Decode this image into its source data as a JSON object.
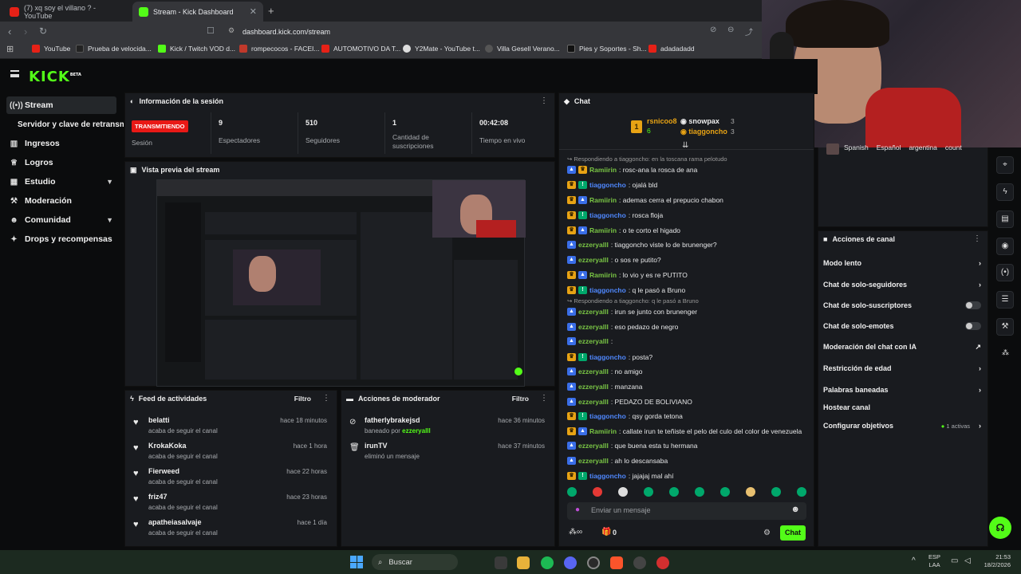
{
  "browser": {
    "tabs": [
      {
        "title": "(7) xq soy el villano ? - YouTube",
        "active": false
      },
      {
        "title": "Stream - Kick Dashboard",
        "active": true
      }
    ],
    "url": "dashboard.kick.com/stream",
    "bookmarks": [
      "YouTube",
      "Prueba de velocida...",
      "Kick / Twitch VOD d...",
      "rompecocos - FACEI...",
      "AUTOMOTIVO DA T...",
      "Y2Mate - YouTube t...",
      "Villa Gesell Verano...",
      "Pies y Soportes - Sh...",
      "adadadadd"
    ]
  },
  "brand": {
    "logo": "KICK",
    "beta": "BETA"
  },
  "sidebar": {
    "items": [
      {
        "label": "Stream",
        "active": true,
        "icon": "broadcast-icon"
      },
      {
        "label": "Servidor y clave de retransmisión",
        "sub": true
      },
      {
        "label": "Ingresos",
        "icon": "chart-icon"
      },
      {
        "label": "Logros",
        "icon": "trophy-icon"
      },
      {
        "label": "Estudio",
        "icon": "grid-icon",
        "chevron": true
      },
      {
        "label": "Moderación",
        "icon": "wrench-icon"
      },
      {
        "label": "Comunidad",
        "icon": "users-icon",
        "chevron": true
      },
      {
        "label": "Drops y recompensas",
        "icon": "gift-icon"
      }
    ]
  },
  "session": {
    "title": "Información de la sesión",
    "status_badge": "TRANSMITIENDO",
    "status_label": "Sesión",
    "stats": [
      {
        "value": "9",
        "label": "Espectadores"
      },
      {
        "value": "510",
        "label": "Seguidores"
      },
      {
        "value": "1",
        "label": "Cantidad de suscripciones"
      },
      {
        "value": "00:42:08",
        "label": "Tiempo en vivo"
      }
    ]
  },
  "preview": {
    "title": "Vista previa del stream"
  },
  "feed": {
    "title": "Feed de actividades",
    "filter": "Filtro",
    "items": [
      {
        "name": "belatti",
        "sub": "acaba de seguir el canal",
        "time": "hace 18 minutos"
      },
      {
        "name": "KrokaKoka",
        "sub": "acaba de seguir el canal",
        "time": "hace 1 hora"
      },
      {
        "name": "Fierweed",
        "sub": "acaba de seguir el canal",
        "time": "hace 22 horas"
      },
      {
        "name": "friz47",
        "sub": "acaba de seguir el canal",
        "time": "hace 23 horas"
      },
      {
        "name": "apatheiasalvaje",
        "sub": "acaba de seguir el canal",
        "time": "hace 1 día"
      }
    ]
  },
  "modactions": {
    "title": "Acciones de moderador",
    "filter": "Filtro",
    "items": [
      {
        "name": "fatherlybrakejsd",
        "sub_prefix": "baneado por",
        "sub_user": "ezzeryalll",
        "time": "hace 36 minutos",
        "icon": "ban-icon"
      },
      {
        "name": "irunTV",
        "sub_prefix": "eliminó un mensaje",
        "sub_user": "",
        "time": "hace 37 minutos",
        "icon": "trash-icon"
      }
    ]
  },
  "chat": {
    "title": "Chat",
    "top_gifters": [
      {
        "rank": "1",
        "name": "rsnicoo8",
        "count": "6"
      },
      {
        "name": "snowpax",
        "count": "3"
      },
      {
        "name": "tiaggoncho",
        "count": "3"
      }
    ],
    "reply_banner": "Respondiendo a tiaggoncho: en la toscana rama pelotudo",
    "reply_banner2": "Respondiendo a tiaggoncho: q le pasó a Bruno",
    "messages": [
      {
        "user": "Ramiirin",
        "text": ": rosc-ana la rosca de ana",
        "color": "#79c544",
        "badges": [
          "blue",
          "crown"
        ]
      },
      {
        "user": "tiaggoncho",
        "text": ": ojalá bld",
        "color": "#4f88ff",
        "badges": [
          "crown",
          "mod"
        ]
      },
      {
        "user": "Ramiirin",
        "text": ": ademas cerra el prepucio chabon",
        "color": "#79c544",
        "badges": [
          "crown",
          "blue"
        ]
      },
      {
        "user": "tiaggoncho",
        "text": ": rosca floja",
        "color": "#4f88ff",
        "badges": [
          "crown",
          "mod"
        ]
      },
      {
        "user": "Ramiirin",
        "text": ": o te corto el higado",
        "color": "#79c544",
        "badges": [
          "crown",
          "blue"
        ]
      },
      {
        "user": "ezzeryalll",
        "text": ": tiaggoncho viste lo de brunenger?",
        "color": "#79c544",
        "badges": [
          "blue"
        ]
      },
      {
        "user": "ezzeryalll",
        "text": ": o sos re putito?",
        "color": "#79c544",
        "badges": [
          "blue"
        ]
      },
      {
        "user": "Ramiirin",
        "text": ": lo vio y es re PUTITO",
        "color": "#79c544",
        "badges": [
          "crown",
          "blue"
        ]
      },
      {
        "user": "tiaggoncho",
        "text": ": q le pasó a Bruno",
        "color": "#4f88ff",
        "badges": [
          "crown",
          "mod"
        ]
      },
      {
        "user": "ezzeryalll",
        "text": ": irun se junto con brunenger",
        "color": "#79c544",
        "badges": [
          "blue"
        ]
      },
      {
        "user": "ezzeryalll",
        "text": ": eso pedazo de negro",
        "color": "#79c544",
        "badges": [
          "blue"
        ]
      },
      {
        "user": "ezzeryalll",
        "text": ": ",
        "color": "#79c544",
        "badges": [
          "blue"
        ]
      },
      {
        "user": "tiaggoncho",
        "text": ": posta?",
        "color": "#4f88ff",
        "badges": [
          "crown",
          "mod"
        ]
      },
      {
        "user": "ezzeryalll",
        "text": ": no amigo",
        "color": "#79c544",
        "badges": [
          "blue"
        ]
      },
      {
        "user": "ezzeryalll",
        "text": ": manzana",
        "color": "#79c544",
        "badges": [
          "blue"
        ]
      },
      {
        "user": "ezzeryalll",
        "text": ": PEDAZO DE BOLIVIANO",
        "color": "#79c544",
        "badges": [
          "blue"
        ]
      },
      {
        "user": "tiaggoncho",
        "text": ": qsy gorda tetona",
        "color": "#4f88ff",
        "badges": [
          "crown",
          "mod"
        ]
      },
      {
        "user": "Ramiirin",
        "text": ": callate irun te teñiste el pelo del culo del color de venezuela",
        "color": "#79c544",
        "badges": [
          "crown",
          "blue"
        ]
      },
      {
        "user": "ezzeryalll",
        "text": ": que buena esta tu hermana",
        "color": "#79c544",
        "badges": [
          "blue"
        ]
      },
      {
        "user": "ezzeryalll",
        "text": ": ah lo descansaba",
        "color": "#79c544",
        "badges": [
          "blue"
        ]
      },
      {
        "user": "tiaggoncho",
        "text": ": jajajaj mal ahí",
        "color": "#4f88ff",
        "badges": [
          "crown",
          "mod"
        ]
      }
    ],
    "input_placeholder": "Enviar un mensaje",
    "points": "0",
    "send_label": "Chat"
  },
  "channel_tags": [
    "Spanish",
    "Español",
    "argentina",
    "count"
  ],
  "channel_actions": {
    "title": "Acciones de canal",
    "items": [
      {
        "label": "Modo lento",
        "control": "chevron"
      },
      {
        "label": "Chat de solo-seguidores",
        "control": "chevron"
      },
      {
        "label": "Chat de solo-suscriptores",
        "control": "toggle"
      },
      {
        "label": "Chat de solo-emotes",
        "control": "toggle"
      },
      {
        "label": "Moderación del chat con IA",
        "control": "external"
      },
      {
        "label": "Restricción de edad",
        "control": "chevron"
      },
      {
        "label": "Palabras baneadas",
        "control": "chevron"
      },
      {
        "label": "Hostear canal",
        "control": "none"
      },
      {
        "label": "Configurar objetivos",
        "control": "chevron",
        "extra": "1 activas"
      }
    ]
  },
  "taskbar": {
    "search": "Buscar",
    "lang": "ESP",
    "lang2": "LAA",
    "time": "21:53",
    "date": "18/2/2026"
  },
  "colors": {
    "accent": "#53fc18",
    "live": "#e91916",
    "panel": "#191b1f",
    "bg": "#0b0c0d"
  }
}
